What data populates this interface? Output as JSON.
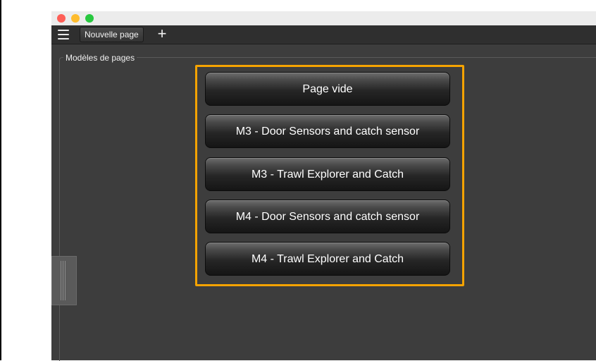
{
  "tabs": [
    {
      "label": "Nouvelle page"
    }
  ],
  "add_tab_label": "+",
  "group": {
    "title": "Modèles de pages",
    "buttons": [
      {
        "label": "Page vide"
      },
      {
        "label": "M3 - Door Sensors and catch sensor"
      },
      {
        "label": "M3 - Trawl Explorer and Catch"
      },
      {
        "label": "M4 - Door Sensors and catch sensor"
      },
      {
        "label": "M4 - Trawl Explorer and Catch"
      }
    ]
  },
  "colors": {
    "window_bg": "#3d3d3d",
    "highlight": "#f5a300",
    "close": "#fe5f57",
    "minimize": "#febc2e",
    "maximize": "#28c840"
  },
  "icons": [
    "hamburger-menu-icon",
    "plus-icon"
  ]
}
